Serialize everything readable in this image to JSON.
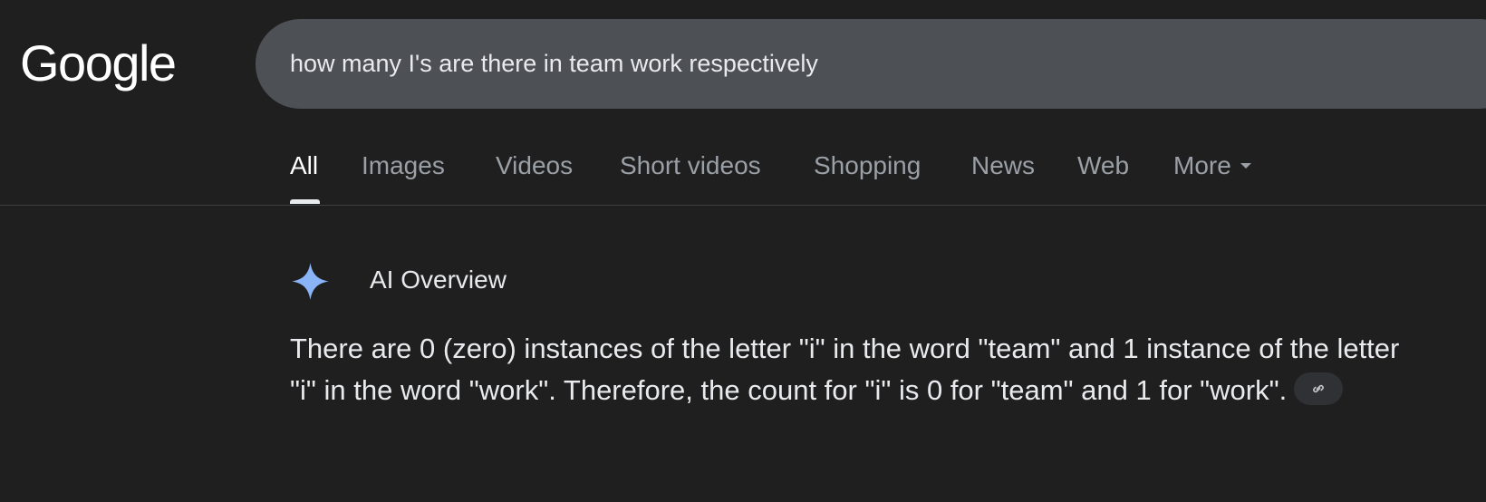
{
  "header": {
    "logo_text": "Google",
    "search": {
      "query": "how many I's are there in team work respectively"
    }
  },
  "tabs": [
    {
      "label": "All",
      "active": true
    },
    {
      "label": "Images",
      "active": false
    },
    {
      "label": "Videos",
      "active": false
    },
    {
      "label": "Short videos",
      "active": false
    },
    {
      "label": "Shopping",
      "active": false
    },
    {
      "label": "News",
      "active": false
    },
    {
      "label": "Web",
      "active": false
    },
    {
      "label": "More",
      "active": false
    }
  ],
  "ai_overview": {
    "title": "AI Overview",
    "answer_text": "There are 0 (zero) instances of the letter \"i\" in the word \"team\" and 1 instance of the letter \"i\" in the word \"work\". Therefore, the count for \"i\" is 0 for \"team\" and 1 for \"work\".",
    "link_icon": "link-icon"
  },
  "colors": {
    "background": "#1f1f1f",
    "search_bar": "#4d5156",
    "text_primary": "#e8eaed",
    "text_secondary": "#9aa0a6",
    "ai_sparkle": "#8ab4f8"
  }
}
